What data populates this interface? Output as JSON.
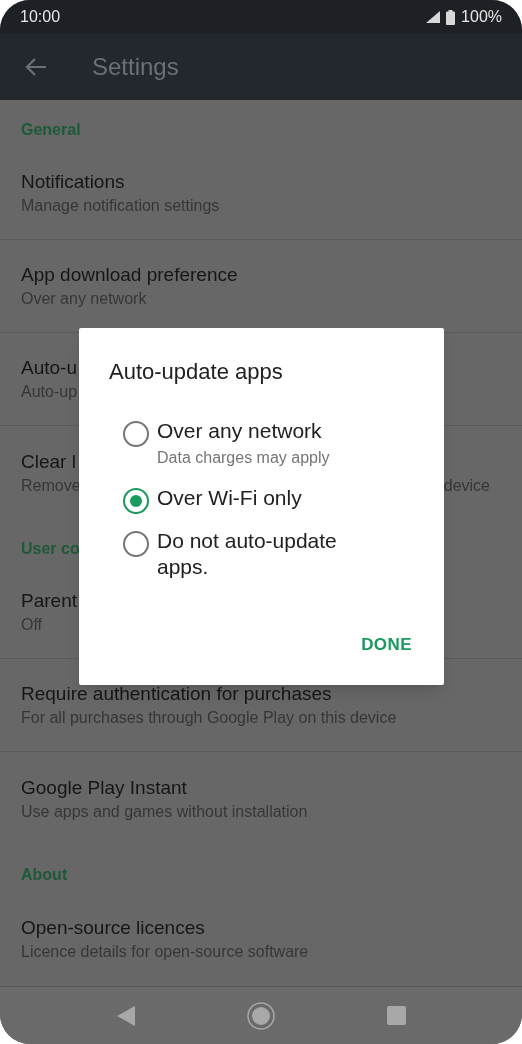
{
  "status_bar": {
    "time": "10:00",
    "battery": "100%"
  },
  "header": {
    "title": "Settings"
  },
  "sections": [
    {
      "header": "General",
      "items": [
        {
          "title": "Notifications",
          "subtitle": "Manage notification settings"
        },
        {
          "title": "App download preference",
          "subtitle": "Over any network"
        },
        {
          "title": "Auto-u",
          "subtitle": "Auto-up"
        },
        {
          "title": "Clear l",
          "subtitle": "Remove",
          "subtitle_end": "device"
        }
      ]
    },
    {
      "header": "User co",
      "items": [
        {
          "title": "Parent",
          "subtitle": "Off"
        },
        {
          "title": "Require authentication for purchases",
          "subtitle": "For all purchases through Google Play on this device"
        },
        {
          "title": "Google Play Instant",
          "subtitle": "Use apps and games without installation"
        }
      ]
    },
    {
      "header": "About",
      "items": [
        {
          "title": "Open-source licences",
          "subtitle": "Licence details for open-source software"
        }
      ]
    }
  ],
  "dialog": {
    "title": "Auto-update apps",
    "options": [
      {
        "label": "Over any network",
        "description": "Data charges may apply",
        "selected": false
      },
      {
        "label": "Over Wi-Fi only",
        "selected": true
      },
      {
        "label": "Do not auto-update apps.",
        "selected": false
      }
    ],
    "button": "DONE"
  }
}
